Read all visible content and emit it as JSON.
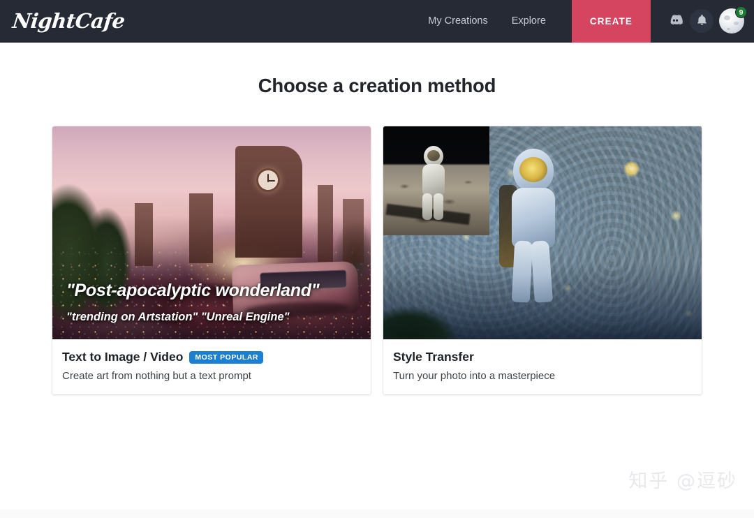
{
  "header": {
    "logo": "NightCafe",
    "nav": [
      {
        "label": "My Creations",
        "name": "nav-my-creations"
      },
      {
        "label": "Explore",
        "name": "nav-explore"
      }
    ],
    "create_button": "CREATE",
    "create_button_color": "#d6455f",
    "background_color": "#252a35",
    "icons": [
      {
        "name": "discord-icon"
      },
      {
        "name": "bell-icon"
      }
    ],
    "avatar": {
      "name": "avatar",
      "badge_count": "9",
      "badge_color": "#1f7a33"
    }
  },
  "main": {
    "title": "Choose a creation method",
    "cards": [
      {
        "title": "Text to Image / Video",
        "badge": "MOST POPULAR",
        "badge_color": "#1b7fd4",
        "subtitle": "Create art from nothing but a text prompt",
        "overlay_prompt": "\"Post-apocalyptic wonderland\"",
        "overlay_modifiers": "\"trending on Artstation\" \"Unreal Engine\""
      },
      {
        "title": "Style Transfer",
        "badge": "",
        "subtitle": "Turn your photo into a masterpiece",
        "overlay_prompt": "",
        "overlay_modifiers": ""
      }
    ]
  },
  "watermark": "知乎 @逗砂"
}
